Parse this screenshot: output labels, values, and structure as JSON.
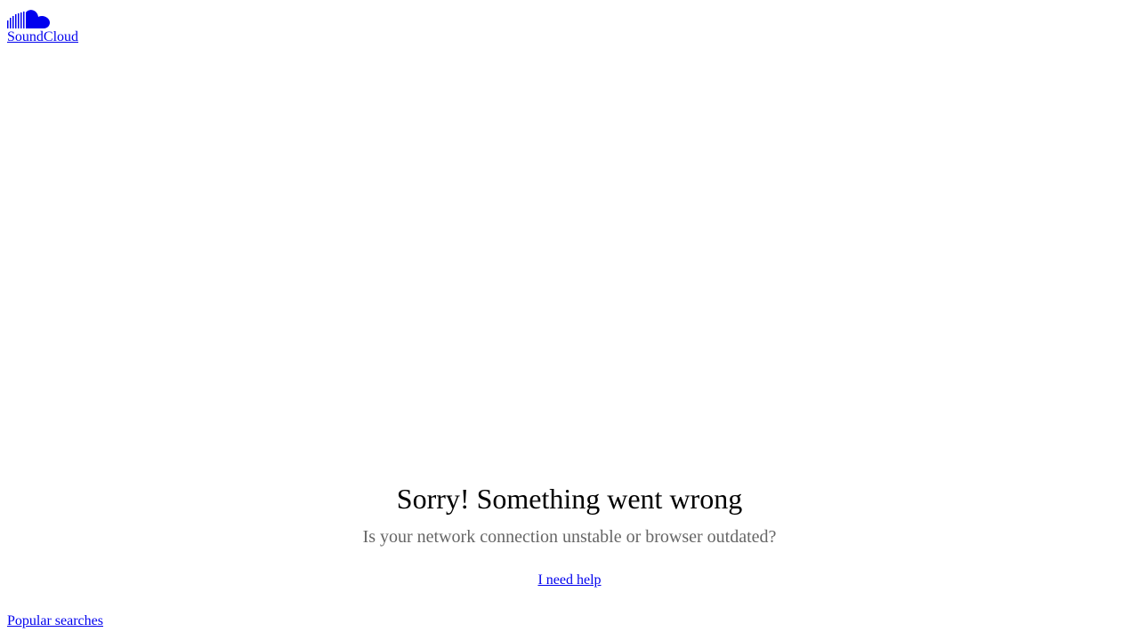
{
  "header": {
    "logo_icon": "soundcloud-cloud-icon",
    "logo_text": "SoundCloud"
  },
  "error": {
    "title": "Sorry! Something went wrong",
    "subtitle": "Is your network connection unstable or browser outdated?",
    "help_link": "I need help"
  },
  "footer": {
    "popular_searches": "Popular searches"
  },
  "colors": {
    "link": "#0000ee",
    "title": "#000000",
    "subtitle": "#666666",
    "background": "#ffffff"
  }
}
